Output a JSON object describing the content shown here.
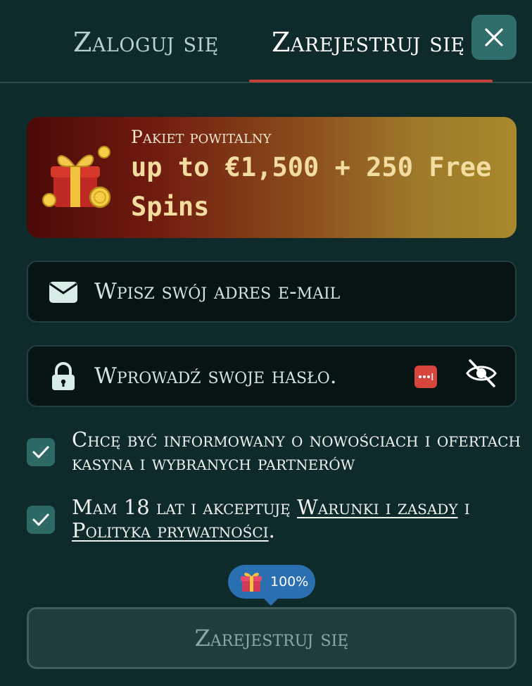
{
  "tabs": {
    "login_label": "Zaloguj się",
    "register_label": "Zarejestruj się",
    "active": "register"
  },
  "promo": {
    "kicker": "Pakiet powitalny",
    "title": "up to €1,500 + 250 Free Spins",
    "icon": "gift-coins-icon"
  },
  "form": {
    "email_placeholder": "Wpisz swój adres e-mail",
    "password_placeholder": "Wprowadź swoje hasło."
  },
  "consents": {
    "marketing_text": "Chcę być informowany o nowościach i ofertach kasyna i wybranych partnerów",
    "marketing_checked": true,
    "terms_prefix": "Mam 18 lat i akceptuję ",
    "terms_link": "Warunki i zasady",
    "terms_middle": " i ",
    "privacy_link": "Polityka prywatności",
    "terms_suffix": ".",
    "terms_checked": true
  },
  "progress": {
    "value_label": "100%",
    "value": 100
  },
  "submit_label": "Zarejestruj się",
  "colors": {
    "background": "#0f2a2b",
    "accent_underline": "#c2403a",
    "checkbox": "#2d6a66",
    "progress": "#2a6fb0"
  }
}
